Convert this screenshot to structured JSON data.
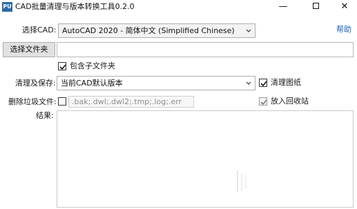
{
  "window": {
    "icon_text": "PU",
    "title": "CAD批量清理与版本转换工具0.2.0",
    "minimize_glyph": "—",
    "close_glyph": "✕"
  },
  "cad_select": {
    "label": "选择CAD:",
    "value": "AutoCAD 2020 - 简体中文 (Simplified Chinese)"
  },
  "help_link": "帮助",
  "folder": {
    "button_label": "选择文件夹",
    "path_value": ""
  },
  "include_subfolders": {
    "label": "包含子文件夹",
    "checked": true
  },
  "clean_save": {
    "label": "清理及保存:",
    "value": "当前CAD默认版本"
  },
  "clean_drawing": {
    "label": "清理图纸",
    "checked": true
  },
  "delete_junk": {
    "label": "删除垃圾文件:",
    "checked": false,
    "extensions": ".bak;.dwl;.dwl2;.tmp;.log;.err"
  },
  "recycle_bin": {
    "label": "放入回收站",
    "checked": true,
    "enabled": false
  },
  "results": {
    "label": "结果:"
  }
}
